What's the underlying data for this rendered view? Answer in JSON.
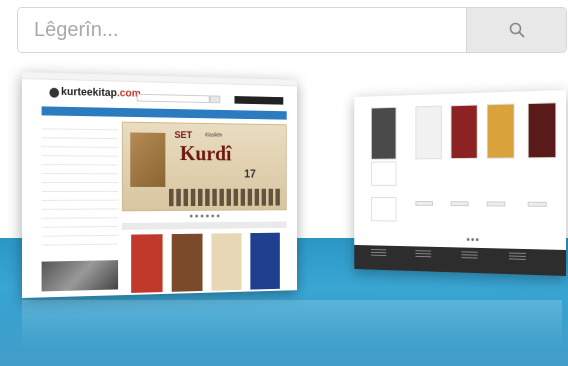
{
  "search": {
    "placeholder": "Lêgerîn...",
    "icon": "search-icon"
  },
  "left_screen": {
    "logo_name": "kurteekitap",
    "logo_suffix": ".com",
    "tagline": "",
    "nav_items": [
      "",
      "",
      "",
      "",
      "",
      "",
      "",
      ""
    ],
    "banner": {
      "set_label": "SET",
      "klasik_label": "Klasîkên",
      "title": "Kurdî",
      "count": "17"
    },
    "section_title": "",
    "books": [
      {
        "color": "#c0392b"
      },
      {
        "color": "#7a4a2a"
      },
      {
        "color": "#e7d7b5"
      },
      {
        "color": "#1f3f8f"
      }
    ]
  },
  "right_screen": {
    "cards": [
      {
        "color": "#4a4a4a"
      },
      {
        "color": "#f1f1f1"
      },
      {
        "color": "#8d2222"
      },
      {
        "color": "#d9a23a"
      },
      {
        "color": "#5a1a1a"
      }
    ],
    "partners": [
      {
        "label": "",
        "color": "#c0392b"
      },
      {
        "label": "",
        "color": "#333"
      },
      {
        "label": "",
        "color": "#c0392b"
      },
      {
        "label": "",
        "color": "#2a7bbf"
      },
      {
        "label": "",
        "color": "#c0392b"
      },
      {
        "label": "",
        "color": "#d4a300"
      }
    ]
  },
  "colors": {
    "blue_band": "#2b97c6",
    "search_button_bg": "#e8e8e8",
    "nav_blue": "#2a7bbf"
  }
}
